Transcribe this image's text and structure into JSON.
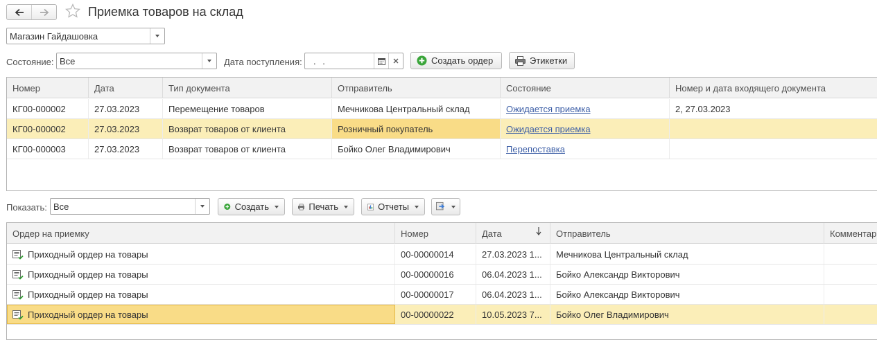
{
  "header": {
    "title": "Приемка товаров на склад"
  },
  "store": {
    "value": "Магазин Гайдашовка"
  },
  "filters": {
    "state_label": "Состояние:",
    "state_value": "Все",
    "date_label": "Дата поступления:",
    "date_value": ".  ."
  },
  "toolbar_top": {
    "create_order": "Создать ордер",
    "labels": "Этикетки"
  },
  "top_table": {
    "columns": [
      "Номер",
      "Дата",
      "Тип документа",
      "Отправитель",
      "Состояние",
      "Номер и дата входящего документа"
    ],
    "rows": [
      [
        "КГ00-000002",
        "27.03.2023",
        "Перемещение товаров",
        "Мечникова Центральный склад",
        "Ожидается приемка",
        "2, 27.03.2023"
      ],
      [
        "КГ00-000002",
        "27.03.2023",
        "Возврат товаров от клиента",
        "Розничный покупатель",
        "Ожидается приемка",
        ""
      ],
      [
        "КГ00-000003",
        "27.03.2023",
        "Возврат товаров от клиента",
        "Бойко Олег Владимирович",
        "Перепоставка",
        ""
      ]
    ]
  },
  "toolbar_bottom": {
    "show_label": "Показать:",
    "show_value": "Все",
    "create": "Создать",
    "print": "Печать",
    "reports": "Отчеты"
  },
  "bottom_table": {
    "columns": [
      "Ордер на приемку",
      "Номер",
      "Дата",
      "Отправитель",
      "Комментарий"
    ],
    "rows": [
      [
        "Приходный ордер на товары",
        "00-00000014",
        "27.03.2023 1...",
        "Мечникова Центральный склад",
        ""
      ],
      [
        "Приходный ордер на товары",
        "00-00000016",
        "06.04.2023 1...",
        "Бойко Александр Викторович",
        ""
      ],
      [
        "Приходный ордер на товары",
        "00-00000017",
        "06.04.2023 1...",
        "Бойко Александр Викторович",
        ""
      ],
      [
        "Приходный ордер на товары",
        "00-00000022",
        "10.05.2023 7...",
        "Бойко Олег Владимирович",
        ""
      ]
    ]
  },
  "colors": {
    "selection": "#fbeeb8",
    "current_cell": "#f9dc87",
    "link": "#3c5ea6",
    "create_icon": "#3aa53a"
  }
}
